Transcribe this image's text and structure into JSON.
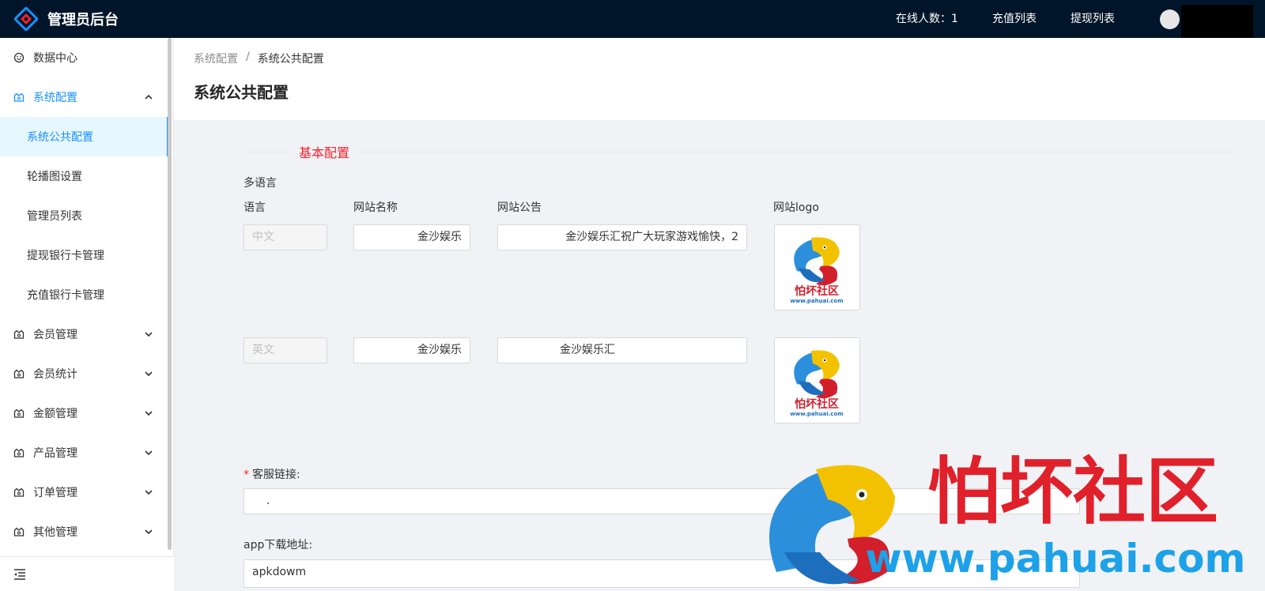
{
  "header": {
    "title": "管理员后台",
    "online_label": "在线人数：1",
    "recharge_link": "充值列表",
    "withdraw_link": "提现列表"
  },
  "sidebar": {
    "items": [
      {
        "label": "数据中心",
        "icon": "dashboard-icon"
      },
      {
        "label": "系统配置",
        "icon": "gear-icon",
        "expanded": true
      },
      {
        "label": "会员管理",
        "icon": "crown-icon"
      },
      {
        "label": "会员统计",
        "icon": "crown-icon"
      },
      {
        "label": "金额管理",
        "icon": "crown-icon"
      },
      {
        "label": "产品管理",
        "icon": "crown-icon"
      },
      {
        "label": "订单管理",
        "icon": "crown-icon"
      },
      {
        "label": "其他管理",
        "icon": "crown-icon"
      }
    ],
    "subitems": [
      {
        "label": "系统公共配置",
        "active": true
      },
      {
        "label": "轮播图设置"
      },
      {
        "label": "管理员列表"
      },
      {
        "label": "提现银行卡管理"
      },
      {
        "label": "充值银行卡管理"
      }
    ]
  },
  "breadcrumb": {
    "parent": "系统配置",
    "separator": "/",
    "current": "系统公共配置"
  },
  "page": {
    "title": "系统公共配置"
  },
  "form": {
    "section_title": "基本配置",
    "multilang_label": "多语言",
    "columns": {
      "language": "语言",
      "site_name": "网站名称",
      "announcement": "网站公告",
      "logo": "网站logo"
    },
    "rows": [
      {
        "language": "中文",
        "site_name": "金沙娱乐",
        "announcement": "金沙娱乐汇祝广大玩家游戏愉快，2"
      },
      {
        "language": "英文",
        "site_name": "金沙娱乐",
        "announcement": "金沙娱乐汇"
      }
    ],
    "logo_text": "怕坏社区",
    "logo_url": "www.pahuai.com",
    "service_link_label": "客服链接:",
    "service_link_required": "*",
    "service_link_value": ".",
    "app_download_label": "app下载地址:",
    "app_download_value": "apkdowm"
  },
  "watermark": {
    "text": "怕坏社区",
    "url": "www.pahuai.com"
  },
  "colors": {
    "header_bg": "#001529",
    "accent": "#1890ff",
    "danger": "#f5222d"
  }
}
